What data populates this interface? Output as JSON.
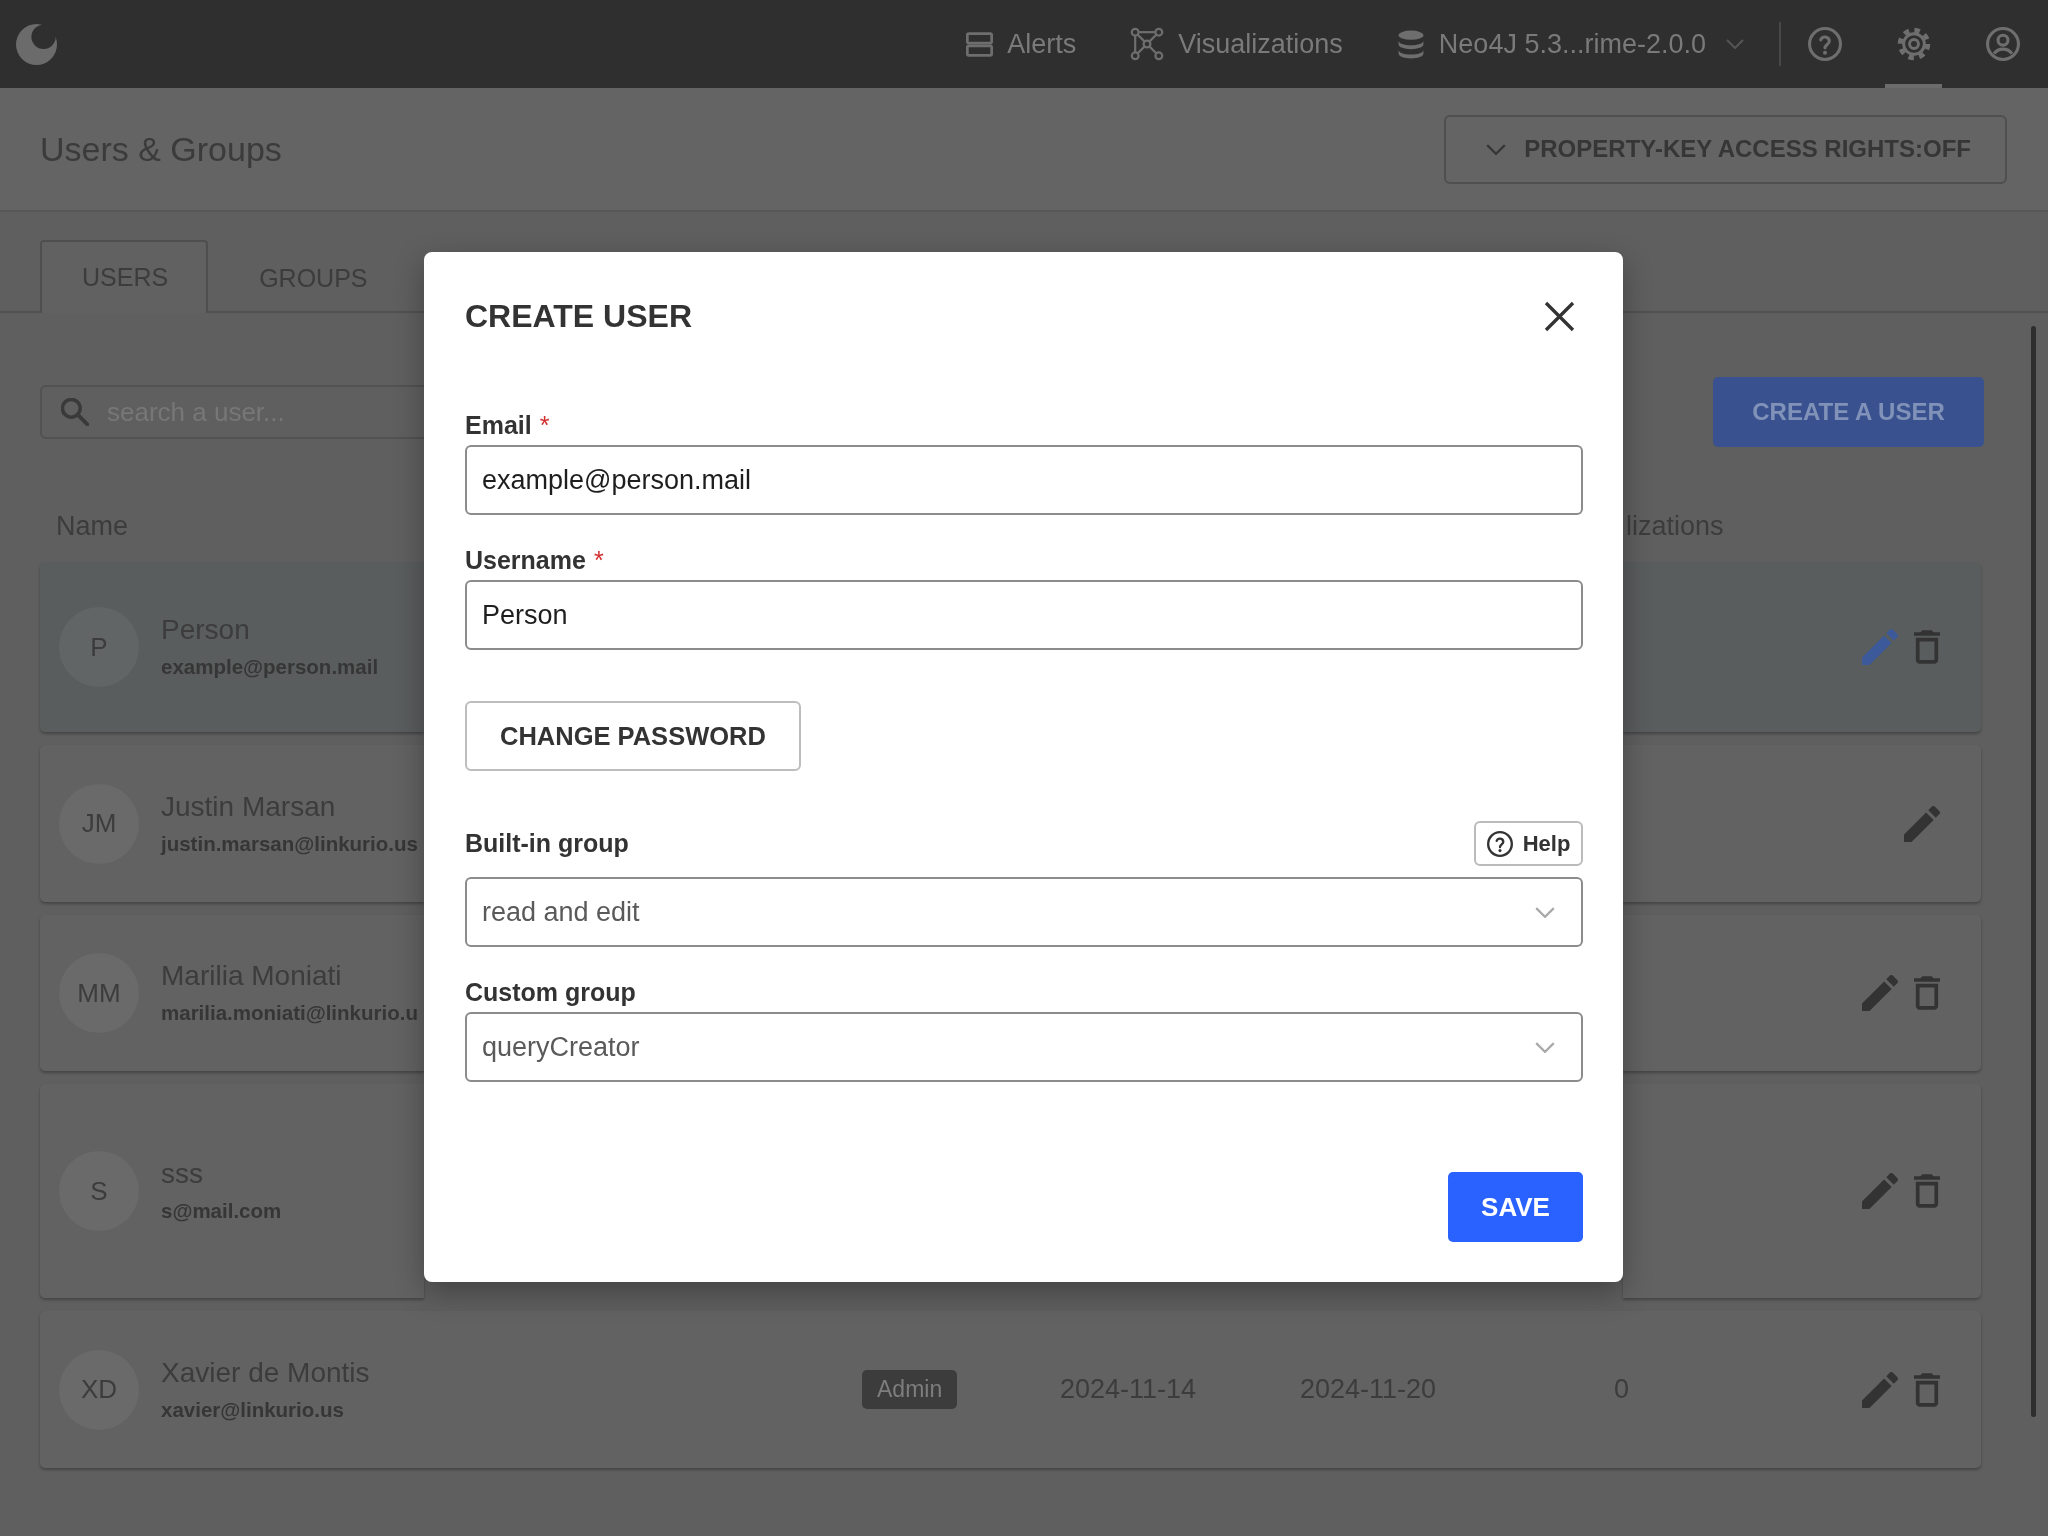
{
  "top_bar": {
    "nav": [
      {
        "kind": "alerts",
        "label": "Alerts"
      },
      {
        "kind": "visualizations",
        "label": "Visualizations"
      },
      {
        "kind": "datasource",
        "label": "Neo4J 5.3...rime-2.0.0"
      }
    ],
    "icons": [
      {
        "kind": "help",
        "selected": false
      },
      {
        "kind": "settings",
        "selected": true
      },
      {
        "kind": "account",
        "selected": false
      }
    ]
  },
  "page_header": {
    "title": "Users & Groups",
    "access_rights_button": "PROPERTY-KEY ACCESS RIGHTS:OFF"
  },
  "tabs": [
    {
      "label": "USERS",
      "selected": true
    },
    {
      "label": "GROUPS",
      "selected": false
    }
  ],
  "search": {
    "placeholder": "search a user..."
  },
  "create_button": "CREATE A USER",
  "table": {
    "columns": [
      {
        "label": "Name"
      },
      {
        "label": "lizations"
      }
    ],
    "rows": [
      {
        "initials": "P",
        "name": "Person",
        "email": "example@person.mail",
        "selected": true,
        "deletable": true
      },
      {
        "initials": "JM",
        "name": "Justin Marsan",
        "email": "justin.marsan@linkurio.us",
        "selected": false,
        "deletable": false
      },
      {
        "initials": "MM",
        "name": "Marilia Moniati",
        "email": "marilia.moniati@linkurio.u",
        "selected": false,
        "deletable": true
      },
      {
        "initials": "S",
        "name": "sss",
        "email": "s@mail.com",
        "selected": false,
        "deletable": true
      },
      {
        "initials": "XD",
        "name": "Xavier de Montis",
        "email": "xavier@linkurio.us",
        "badge": "Admin",
        "date_1": "2024-11-14",
        "date_2": "2024-11-20",
        "count": "0",
        "selected": false,
        "deletable": true
      }
    ]
  },
  "dialog": {
    "title": "CREATE USER",
    "fields": [
      {
        "kind": "text",
        "label": "Email",
        "required_mark": "*",
        "value": "example@person.mail"
      },
      {
        "kind": "text",
        "label": "Username",
        "required_mark": "*",
        "value": "Person"
      },
      {
        "kind": "button",
        "label": "CHANGE PASSWORD"
      },
      {
        "kind": "select",
        "label": "Built-in group",
        "help": "Help",
        "value": "read and edit"
      },
      {
        "kind": "select",
        "label": "Custom group",
        "value": "queryCreator"
      }
    ],
    "save_button": "SAVE"
  }
}
